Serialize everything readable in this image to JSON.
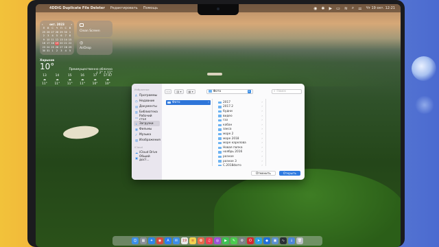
{
  "menubar": {
    "apple_glyph": "",
    "app_name": "4DDiG Duplicate File Deleter",
    "menus": [
      "Редактировать",
      "Помощь"
    ],
    "clock": "Чт 19 окт.  12:21"
  },
  "calendar": {
    "month": "окт. 2023",
    "weekdays": [
      "П",
      "В",
      "С",
      "Ч",
      "П",
      "С",
      "В"
    ],
    "days": [
      "25",
      "26",
      "27",
      "28",
      "29",
      "30",
      "1",
      "2",
      "3",
      "4",
      "5",
      "6",
      "7",
      "8",
      "9",
      "10",
      "11",
      "12",
      "13",
      "14",
      "15",
      "16",
      "17",
      "18",
      "19",
      "20",
      "21",
      "22",
      "23",
      "24",
      "25",
      "26",
      "27",
      "28",
      "29",
      "30",
      "31",
      "1",
      "2",
      "3",
      "4",
      "5"
    ],
    "today_index": 24
  },
  "widgets": {
    "clean_screen": "Clean Screen",
    "airdrop": "AirDrop"
  },
  "weather": {
    "city": "Харьков",
    "temp": "10°",
    "condition": "Преимущественно облачно",
    "hi_lo": "↓ 2° ↑ 11°",
    "hours": [
      {
        "time": "13",
        "icon": "☁",
        "temp": "11°"
      },
      {
        "time": "14",
        "icon": "☁",
        "temp": "11°"
      },
      {
        "time": "15",
        "icon": "☁",
        "temp": "11°"
      },
      {
        "time": "16",
        "icon": "☁",
        "temp": "11°"
      },
      {
        "time": "17",
        "icon": "☁",
        "temp": "10°"
      },
      {
        "time": "17:47",
        "icon": "☁",
        "temp": "10°"
      }
    ]
  },
  "dialog": {
    "sidebar_favorites": "Избранное",
    "sidebar_items": [
      {
        "label": "Программы",
        "icon": "A",
        "selected": false
      },
      {
        "label": "Недавние",
        "icon": "◷",
        "selected": false
      },
      {
        "label": "Документы",
        "icon": "▤",
        "selected": false
      },
      {
        "label": "Библиотека",
        "icon": "▥",
        "selected": false
      },
      {
        "label": "Рабочий стол",
        "icon": "▭",
        "selected": false
      },
      {
        "label": "Загрузки",
        "icon": "↓",
        "selected": true
      },
      {
        "label": "Фильмы",
        "icon": "▦",
        "selected": false
      },
      {
        "label": "Музыка",
        "icon": "♪",
        "selected": false
      },
      {
        "label": "Изображения",
        "icon": "▧",
        "selected": false
      }
    ],
    "sidebar_cloud": "iCloud",
    "cloud_items": [
      {
        "label": "iCloud Drive",
        "icon": "☁"
      },
      {
        "label": "Общий дост...",
        "icon": "▣"
      }
    ],
    "path_folder": "Фото",
    "search_placeholder": "Поиск",
    "column1_selected": "Фото",
    "folders": [
      "2017",
      "2017.2",
      "будни",
      "видео",
      "газ",
      "кабан",
      "закса",
      "море 2",
      "море 2018",
      "море карелова",
      "Новая папка",
      "ноябрь 2016",
      "разное",
      "разное 3",
      "С.2018фото"
    ],
    "cancel_label": "Отменить",
    "open_label": "Открыть"
  },
  "dock": {
    "apps": [
      {
        "name": "finder",
        "glyph": "☺",
        "color": "#3b8ee8"
      },
      {
        "name": "launchpad",
        "glyph": "▦",
        "color": "#8a8f99"
      },
      {
        "name": "safari",
        "glyph": "✦",
        "color": "#2f86e6"
      },
      {
        "name": "chrome",
        "glyph": "◉",
        "color": "#d94a3d"
      },
      {
        "name": "app-store",
        "glyph": "A",
        "color": "#2a7cf0"
      },
      {
        "name": "mail",
        "glyph": "✉",
        "color": "#3d8de7"
      },
      {
        "name": "calendar",
        "glyph": "19",
        "color": "#e9e9ea"
      },
      {
        "name": "notes",
        "glyph": "≡",
        "color": "#f3d150"
      },
      {
        "name": "photos",
        "glyph": "✿",
        "color": "#e96b4c"
      },
      {
        "name": "music",
        "glyph": "♫",
        "color": "#ef3e54"
      },
      {
        "name": "podcasts",
        "glyph": "◎",
        "color": "#9b52d8"
      },
      {
        "name": "facetime",
        "glyph": "▶",
        "color": "#3cc253"
      },
      {
        "name": "messages",
        "glyph": "✎",
        "color": "#4acb4e"
      },
      {
        "name": "system-settings",
        "glyph": "⚙",
        "color": "#7e828a"
      },
      {
        "name": "opera",
        "glyph": "O",
        "color": "#d6262f"
      },
      {
        "name": "telegram",
        "glyph": "➤",
        "color": "#2a9fe0"
      },
      {
        "name": "4ddig",
        "glyph": "◆",
        "color": "#1f6fdb"
      },
      {
        "name": "preview",
        "glyph": "▣",
        "color": "#5a8fcf"
      },
      {
        "name": "activity",
        "glyph": "∿",
        "color": "#2b2f36"
      },
      {
        "name": "downloads",
        "glyph": "↓",
        "color": "#4e86d8"
      },
      {
        "name": "trash",
        "glyph": "🗑",
        "color": "#b9bcc2"
      }
    ]
  }
}
